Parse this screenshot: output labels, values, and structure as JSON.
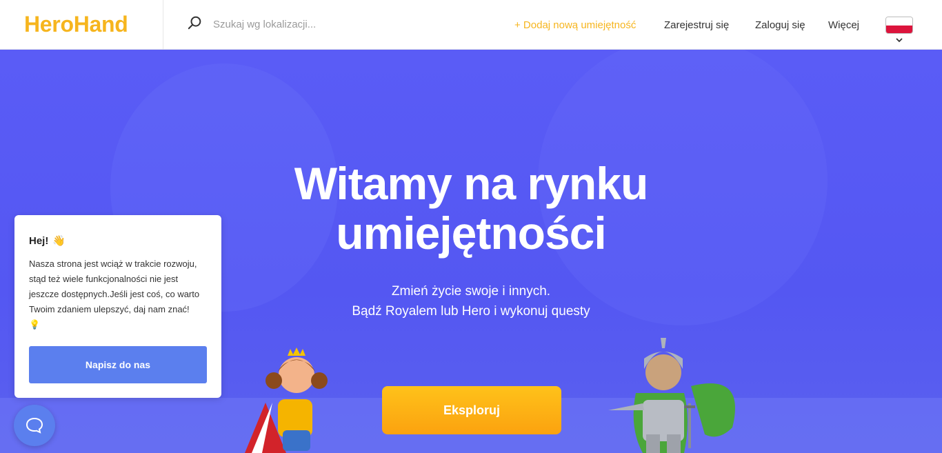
{
  "header": {
    "logo": "HeroHand",
    "search_placeholder": "Szukaj wg lokalizacji...",
    "add_skill": "+ Dodaj nową umiejętność",
    "register": "Zarejestruj się",
    "login": "Zaloguj się",
    "more": "Więcej",
    "language_flag": "poland-flag-icon"
  },
  "hero": {
    "title_line1": "Witamy na rynku",
    "title_line2": "umiejętności",
    "subtitle_line1": "Zmień życie swoje i innych.",
    "subtitle_line2": "Bądź Royalem lub Hero i wykonuj questy",
    "explore_button": "Eksploruj"
  },
  "popup": {
    "title": "Hej!",
    "wave_emoji": "👋",
    "text": "Nasza strona jest wciąż w trakcie rozwoju, stąd też wiele funkcjonalności nie jest jeszcze dostępnych.Jeśli jest coś, co warto Twoim zdaniem ulepszyć, daj nam znać!",
    "bulb_emoji": "💡",
    "button": "Napisz do nas"
  },
  "colors": {
    "brand": "#f6b51e",
    "hero_bg": "#5457f2",
    "accent_button": "#5b7fee"
  }
}
